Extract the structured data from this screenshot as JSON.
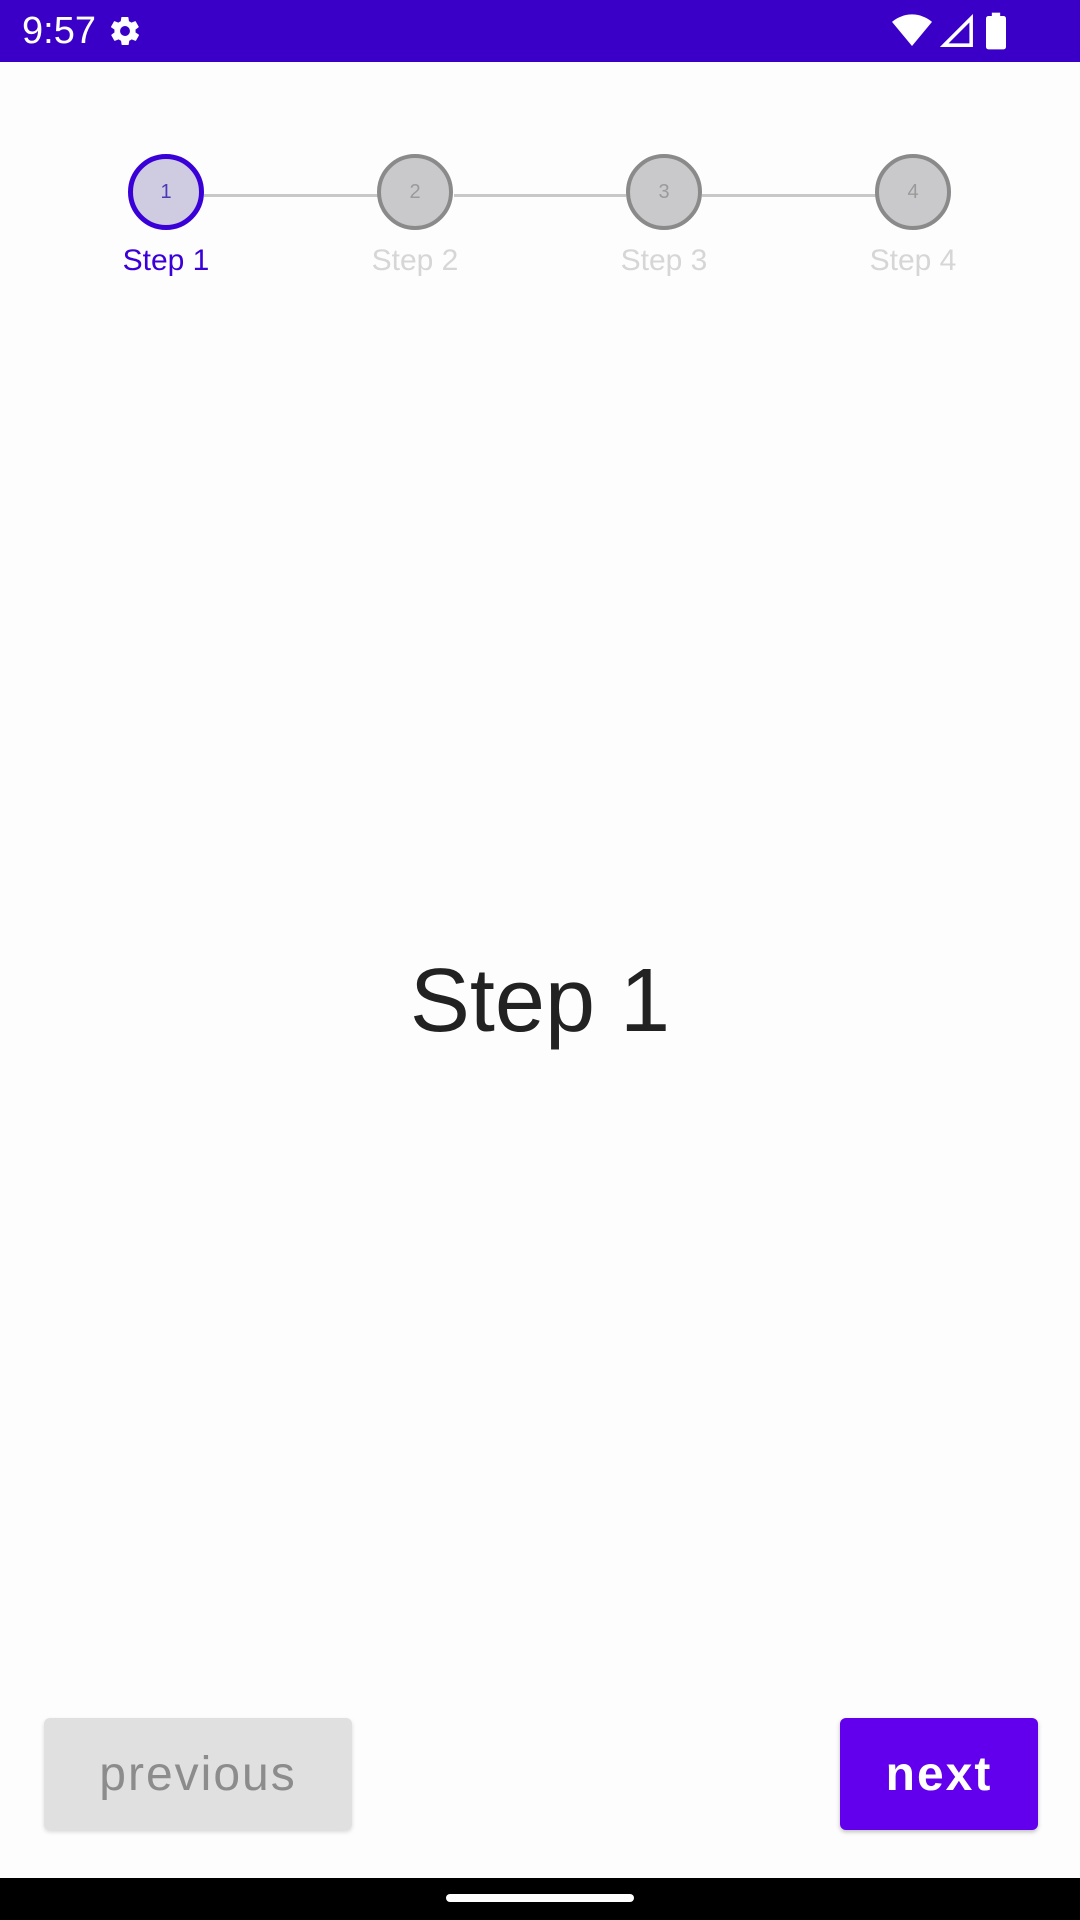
{
  "status_bar": {
    "time": "9:57",
    "icons": [
      "gear-icon",
      "wifi-icon",
      "signal-icon",
      "battery-icon"
    ],
    "background": "#3a00c8"
  },
  "stepper": {
    "active_color": "#3a00d8",
    "steps": [
      {
        "number": "1",
        "label": "Step 1",
        "state": "active"
      },
      {
        "number": "2",
        "label": "Step 2",
        "state": "inactive"
      },
      {
        "number": "3",
        "label": "Step 3",
        "state": "inactive"
      },
      {
        "number": "4",
        "label": "Step 4",
        "state": "inactive"
      }
    ]
  },
  "content": {
    "title": "Step 1"
  },
  "buttons": {
    "previous_label": "previous",
    "previous_enabled": false,
    "next_label": "next",
    "next_color": "#6200ee"
  }
}
